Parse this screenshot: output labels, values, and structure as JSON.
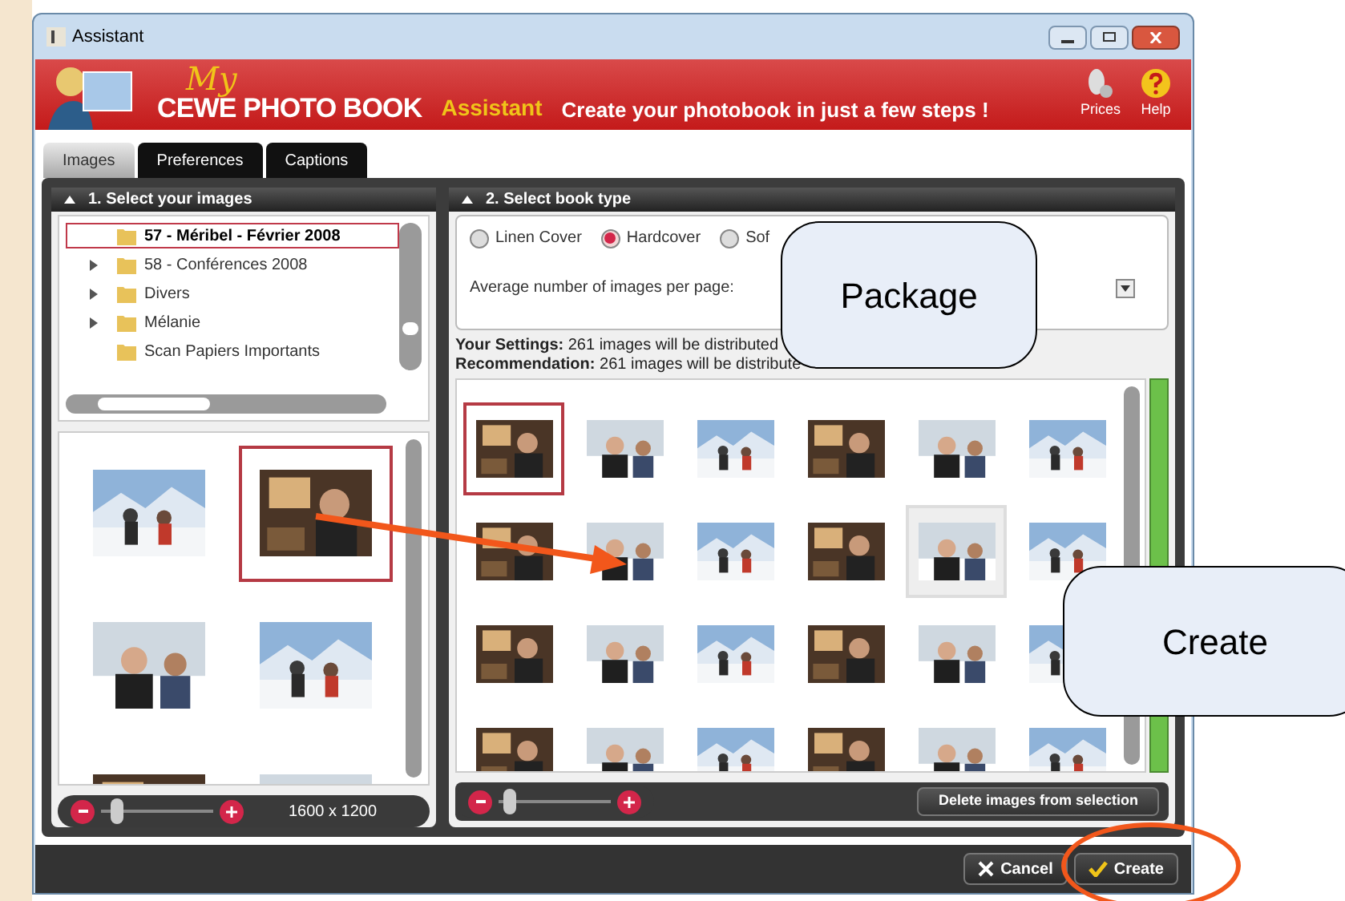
{
  "window": {
    "title": "Assistant"
  },
  "header": {
    "logo_script": "My",
    "logo": "CEWE PHOTO BOOK",
    "subtitle": "Assistant",
    "tagline": "Create your photobook in just a few steps !",
    "actions": [
      {
        "label": "Prices",
        "kind": "prices"
      },
      {
        "label": "Help",
        "kind": "help"
      }
    ]
  },
  "tabs": [
    {
      "label": "Images",
      "selected": true
    },
    {
      "label": "Preferences",
      "selected": false
    },
    {
      "label": "Captions",
      "selected": false
    }
  ],
  "left_panel": {
    "title": "1. Select your images",
    "folders": [
      {
        "name": "57 - Méribel - Février 2008",
        "selected": true,
        "has_children": false
      },
      {
        "name": "58 - Conférences 2008",
        "selected": false,
        "has_children": true
      },
      {
        "name": "Divers",
        "selected": false,
        "has_children": true
      },
      {
        "name": "Mélanie",
        "selected": false,
        "has_children": true
      },
      {
        "name": "Scan Papiers Importants",
        "selected": false,
        "has_children": false
      }
    ],
    "thumbnails": [
      {
        "kind": "picture",
        "selected": false
      },
      {
        "kind": "picture",
        "selected": true
      },
      {
        "kind": "picture",
        "selected": false
      },
      {
        "kind": "picture",
        "selected": false
      },
      {
        "kind": "picture",
        "selected": false
      },
      {
        "kind": "picture",
        "selected": false
      }
    ],
    "zoom": {
      "level": 0.1,
      "reading": "1600 x 1200"
    }
  },
  "right_panel": {
    "title": "2. Select book type",
    "cover_options": [
      {
        "label": "Linen Cover",
        "selected": false
      },
      {
        "label": "Hardcover",
        "selected": true
      },
      {
        "label": "Sof",
        "selected": false
      }
    ],
    "images_per_page_label": "Average number of images per page:",
    "settings": {
      "label": "Your Settings:",
      "text": "261 images will be distributed"
    },
    "recommendation": {
      "label": "Recommendation:",
      "text": "261 images will be distribute"
    },
    "thumbnails": [
      {
        "kind": "picture",
        "selected": true,
        "hovered": false
      },
      {
        "kind": "picture",
        "selected": false,
        "hovered": false
      },
      {
        "kind": "picture",
        "selected": false,
        "hovered": false
      },
      {
        "kind": "picture",
        "selected": false,
        "hovered": false
      },
      {
        "kind": "picture",
        "selected": false,
        "hovered": false
      },
      {
        "kind": "picture",
        "selected": false,
        "hovered": false
      },
      {
        "kind": "picture",
        "selected": false,
        "hovered": false
      },
      {
        "kind": "picture",
        "selected": false,
        "hovered": false
      },
      {
        "kind": "picture",
        "selected": false,
        "hovered": false
      },
      {
        "kind": "picture",
        "selected": false,
        "hovered": false
      },
      {
        "kind": "picture",
        "selected": false,
        "hovered": true
      },
      {
        "kind": "picture",
        "selected": false,
        "hovered": false
      },
      {
        "kind": "picture",
        "selected": false,
        "hovered": false
      },
      {
        "kind": "picture",
        "selected": false,
        "hovered": false
      },
      {
        "kind": "picture",
        "selected": false,
        "hovered": false
      },
      {
        "kind": "picture",
        "selected": false,
        "hovered": false
      },
      {
        "kind": "picture",
        "selected": false,
        "hovered": false
      },
      {
        "kind": "picture",
        "selected": false,
        "hovered": false
      },
      {
        "kind": "picture",
        "selected": false,
        "hovered": false
      },
      {
        "kind": "picture",
        "selected": false,
        "hovered": false
      },
      {
        "kind": "picture",
        "selected": false,
        "hovered": false
      },
      {
        "kind": "picture",
        "selected": false,
        "hovered": false
      },
      {
        "kind": "picture",
        "selected": false,
        "hovered": false
      },
      {
        "kind": "picture",
        "selected": false,
        "hovered": false
      }
    ],
    "zoom": {
      "level": 0.05
    },
    "delete_button": "Delete images from selection"
  },
  "footer": {
    "buttons": [
      {
        "label": "Cancel",
        "kind": "cancel"
      },
      {
        "label": "Create",
        "kind": "confirm"
      }
    ]
  },
  "annotations": [
    {
      "kind": "callout",
      "text": "Package"
    },
    {
      "kind": "callout",
      "text": "Create"
    },
    {
      "kind": "arrow"
    },
    {
      "kind": "ellipse"
    }
  ]
}
